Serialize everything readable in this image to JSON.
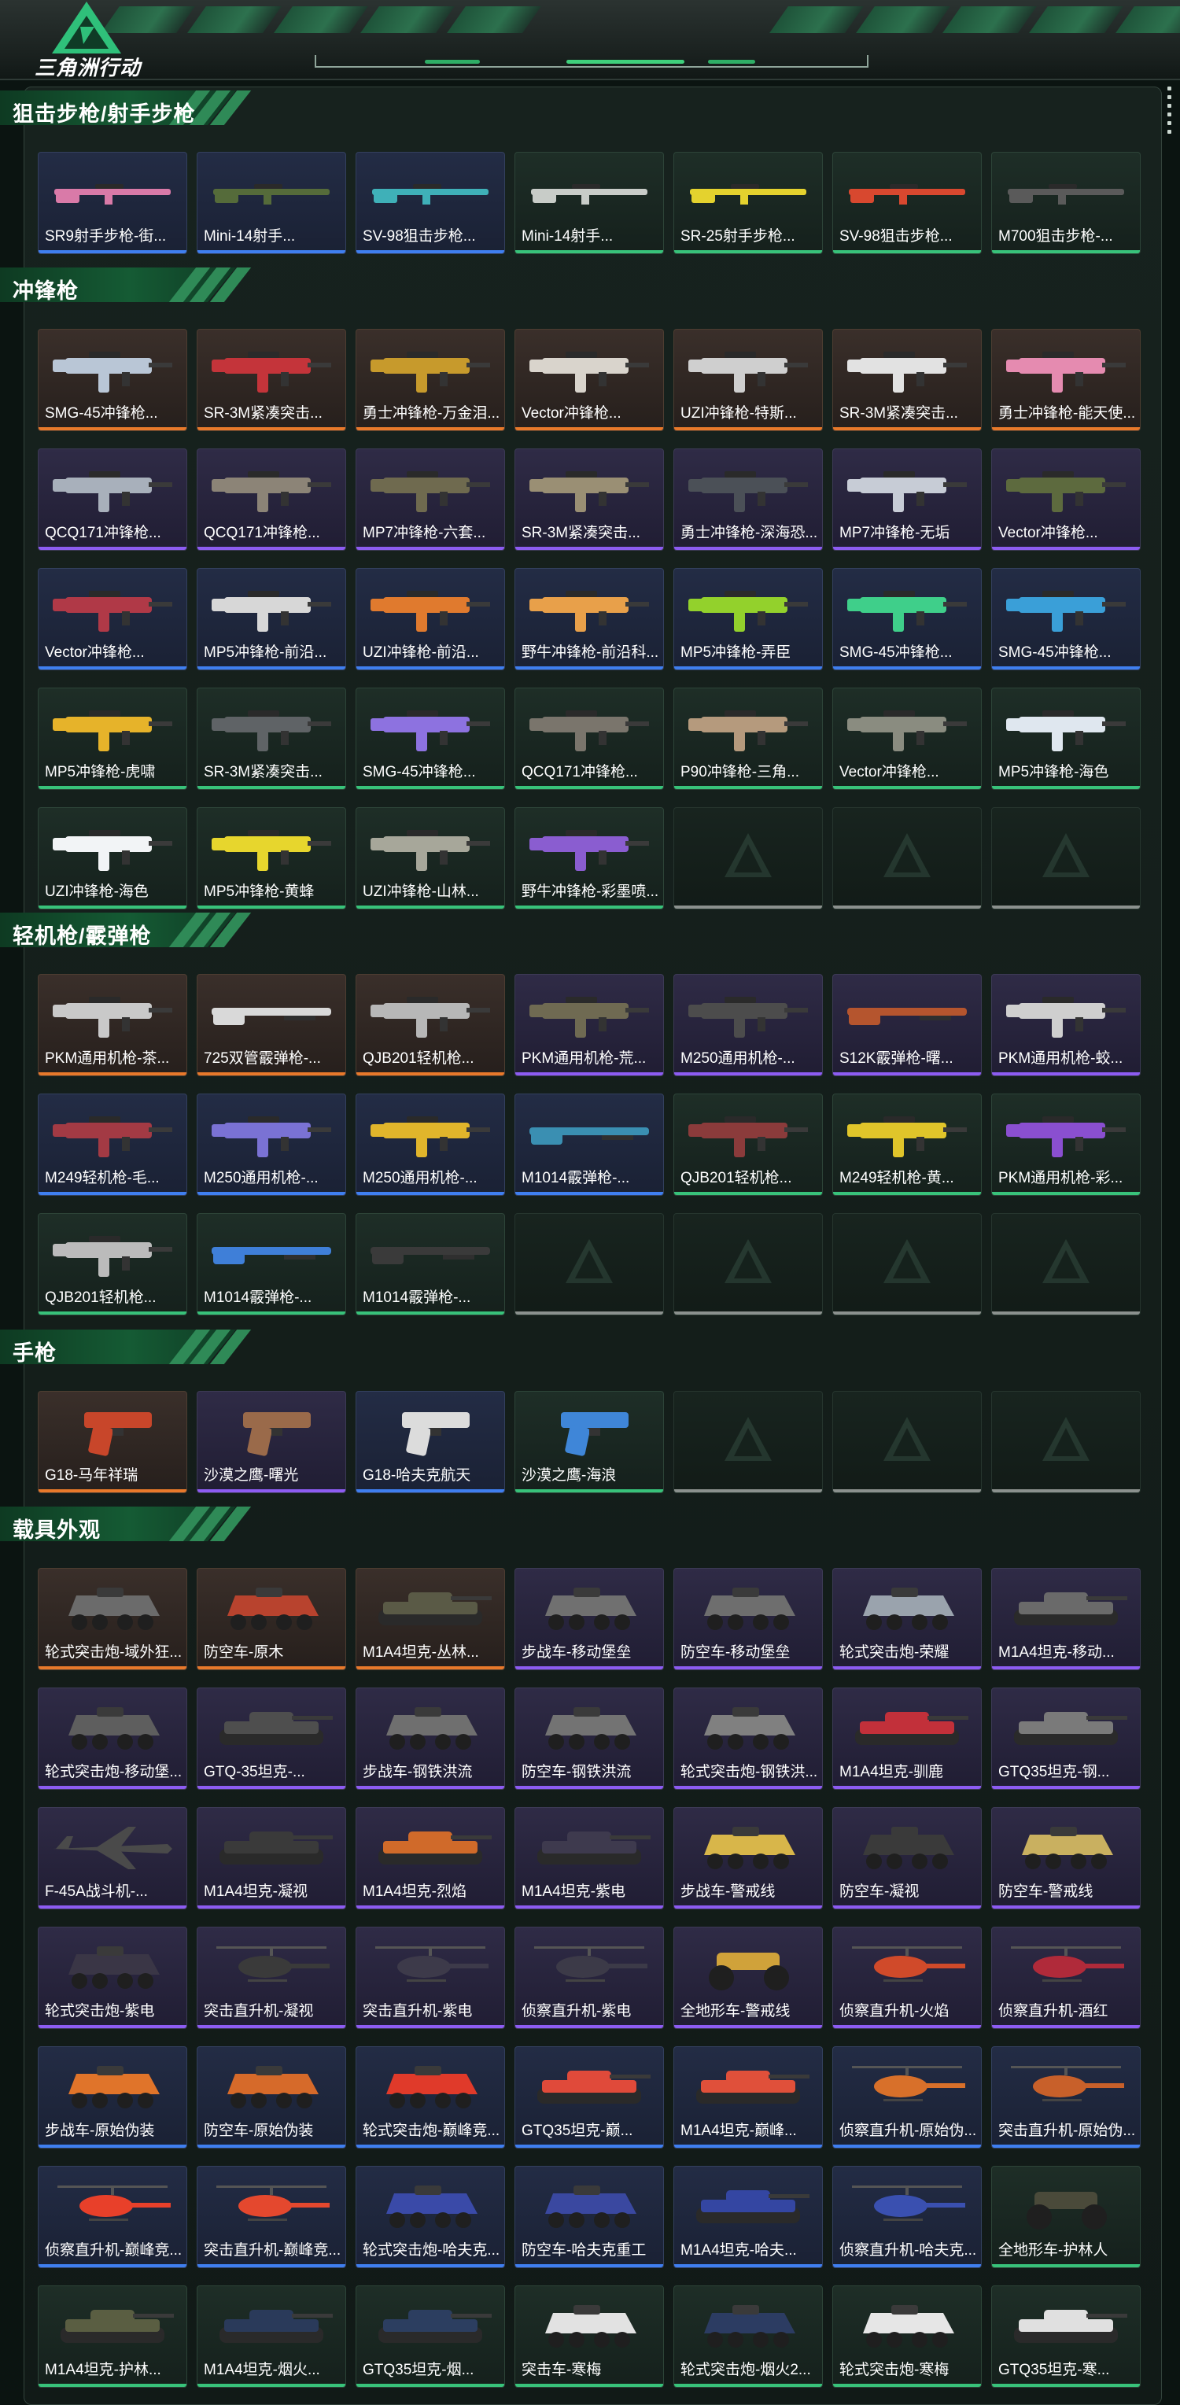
{
  "brand": {
    "logo_text": "三角洲行动",
    "accent": "#2e9a5e"
  },
  "rarity_colors": {
    "orange": "#e8792b",
    "purple": "#8d5cf2",
    "blue": "#3f7ff0",
    "green": "#38c27a",
    "empty": "#8b918e"
  },
  "sections": [
    {
      "title": "狙击步枪/射手步枪",
      "items": [
        {
          "name": "SR9射手步枪-街...",
          "rarity": "blue",
          "icon": "rifle-icon",
          "color": "#d97aa8"
        },
        {
          "name": "Mini-14射手...",
          "rarity": "blue",
          "icon": "rifle-icon",
          "color": "#556b3a"
        },
        {
          "name": "SV-98狙击步枪...",
          "rarity": "blue",
          "icon": "rifle-icon",
          "color": "#3fb0b8"
        },
        {
          "name": "Mini-14射手...",
          "rarity": "green",
          "icon": "rifle-icon",
          "color": "#c8ccc8"
        },
        {
          "name": "SR-25射手步枪...",
          "rarity": "green",
          "icon": "rifle-icon",
          "color": "#e4d22e"
        },
        {
          "name": "SV-98狙击步枪...",
          "rarity": "green",
          "icon": "rifle-icon",
          "color": "#d8482f"
        },
        {
          "name": "M700狙击步枪-...",
          "rarity": "green",
          "icon": "rifle-icon",
          "color": "#5a5a5a"
        }
      ]
    },
    {
      "title": "冲锋枪",
      "items": [
        {
          "name": "SMG-45冲锋枪...",
          "rarity": "orange",
          "icon": "smg-icon",
          "color": "#b9c6d6"
        },
        {
          "name": "SR-3M紧凑突击...",
          "rarity": "orange",
          "icon": "smg-icon",
          "color": "#c4343a"
        },
        {
          "name": "勇士冲锋枪-万金泪...",
          "rarity": "orange",
          "icon": "smg-icon",
          "color": "#c79a2c"
        },
        {
          "name": "Vector冲锋枪...",
          "rarity": "orange",
          "icon": "smg-icon",
          "color": "#d9d4cc"
        },
        {
          "name": "UZI冲锋枪-特斯...",
          "rarity": "orange",
          "icon": "smg-icon",
          "color": "#cfcfcf"
        },
        {
          "name": "SR-3M紧凑突击...",
          "rarity": "orange",
          "icon": "smg-icon",
          "color": "#e2e2e2"
        },
        {
          "name": "勇士冲锋枪-能天使...",
          "rarity": "orange",
          "icon": "smg-icon",
          "color": "#e58bb0"
        },
        {
          "name": "QCQ171冲锋枪...",
          "rarity": "purple",
          "icon": "smg-icon",
          "color": "#a8b0bb"
        },
        {
          "name": "QCQ171冲锋枪...",
          "rarity": "purple",
          "icon": "smg-icon",
          "color": "#8c8477"
        },
        {
          "name": "MP7冲锋枪-六套...",
          "rarity": "purple",
          "icon": "smg-icon",
          "color": "#6f6a4f"
        },
        {
          "name": "SR-3M紧凑突击...",
          "rarity": "purple",
          "icon": "smg-icon",
          "color": "#9a8f74"
        },
        {
          "name": "勇士冲锋枪-深海恐...",
          "rarity": "purple",
          "icon": "smg-icon",
          "color": "#4b5057"
        },
        {
          "name": "MP7冲锋枪-无垢",
          "rarity": "purple",
          "icon": "smg-icon",
          "color": "#c7ccd6"
        },
        {
          "name": "Vector冲锋枪...",
          "rarity": "purple",
          "icon": "smg-icon",
          "color": "#5d6a3e"
        },
        {
          "name": "Vector冲锋枪...",
          "rarity": "blue",
          "icon": "smg-icon",
          "color": "#b03947"
        },
        {
          "name": "MP5冲锋枪-前沿...",
          "rarity": "blue",
          "icon": "smg-icon",
          "color": "#d7d7d7"
        },
        {
          "name": "UZI冲锋枪-前沿...",
          "rarity": "blue",
          "icon": "smg-icon",
          "color": "#e07a2e"
        },
        {
          "name": "野牛冲锋枪-前沿科...",
          "rarity": "blue",
          "icon": "smg-icon",
          "color": "#e8a04a"
        },
        {
          "name": "MP5冲锋枪-弄臣",
          "rarity": "blue",
          "icon": "smg-icon",
          "color": "#93d12c"
        },
        {
          "name": "SMG-45冲锋枪...",
          "rarity": "blue",
          "icon": "smg-icon",
          "color": "#3fcf8a"
        },
        {
          "name": "SMG-45冲锋枪...",
          "rarity": "blue",
          "icon": "smg-icon",
          "color": "#3a9fd8"
        },
        {
          "name": "MP5冲锋枪-虎啸",
          "rarity": "green",
          "icon": "smg-icon",
          "color": "#e6b32a"
        },
        {
          "name": "SR-3M紧凑突击...",
          "rarity": "green",
          "icon": "smg-icon",
          "color": "#5f6366"
        },
        {
          "name": "SMG-45冲锋枪...",
          "rarity": "green",
          "icon": "smg-icon",
          "color": "#8d72e0"
        },
        {
          "name": "QCQ171冲锋枪...",
          "rarity": "green",
          "icon": "smg-icon",
          "color": "#7a756c"
        },
        {
          "name": "P90冲锋枪-三角...",
          "rarity": "green",
          "icon": "smg-icon",
          "color": "#b59a7d"
        },
        {
          "name": "Vector冲锋枪...",
          "rarity": "green",
          "icon": "smg-icon",
          "color": "#8a8c80"
        },
        {
          "name": "MP5冲锋枪-海色",
          "rarity": "green",
          "icon": "smg-icon",
          "color": "#dfe7ef"
        },
        {
          "name": "UZI冲锋枪-海色",
          "rarity": "green",
          "icon": "smg-icon",
          "color": "#f2f4f6"
        },
        {
          "name": "MP5冲锋枪-黄蜂",
          "rarity": "green",
          "icon": "smg-icon",
          "color": "#e7d62d"
        },
        {
          "name": "UZI冲锋枪-山林...",
          "rarity": "green",
          "icon": "smg-icon",
          "color": "#a7a79a"
        },
        {
          "name": "野牛冲锋枪-彩墨喷...",
          "rarity": "green",
          "icon": "smg-icon",
          "color": "#8a5dd0"
        },
        {
          "name": "",
          "rarity": "empty"
        },
        {
          "name": "",
          "rarity": "empty"
        },
        {
          "name": "",
          "rarity": "empty"
        }
      ]
    },
    {
      "title": "轻机枪/霰弹枪",
      "items": [
        {
          "name": "PKM通用机枪-茶...",
          "rarity": "orange",
          "icon": "lmg-icon",
          "color": "#c9c9c9"
        },
        {
          "name": "725双管霰弹枪-...",
          "rarity": "orange",
          "icon": "shotgun-icon",
          "color": "#d9d9d9"
        },
        {
          "name": "QJB201轻机枪...",
          "rarity": "orange",
          "icon": "lmg-icon",
          "color": "#b7b7b7"
        },
        {
          "name": "PKM通用机枪-荒...",
          "rarity": "purple",
          "icon": "lmg-icon",
          "color": "#6f6a52"
        },
        {
          "name": "M250通用机枪-...",
          "rarity": "purple",
          "icon": "lmg-icon",
          "color": "#4c4c4c"
        },
        {
          "name": "S12K霰弹枪-曙...",
          "rarity": "purple",
          "icon": "shotgun-icon",
          "color": "#b5552e"
        },
        {
          "name": "PKM通用机枪-蛟...",
          "rarity": "purple",
          "icon": "lmg-icon",
          "color": "#cfcfcf"
        },
        {
          "name": "M249轻机枪-毛...",
          "rarity": "blue",
          "icon": "lmg-icon",
          "color": "#a33a44"
        },
        {
          "name": "M250通用机枪-...",
          "rarity": "blue",
          "icon": "lmg-icon",
          "color": "#7a72d4"
        },
        {
          "name": "M250通用机枪-...",
          "rarity": "blue",
          "icon": "lmg-icon",
          "color": "#e1b52b"
        },
        {
          "name": "M1014霰弹枪-...",
          "rarity": "blue",
          "icon": "shotgun-icon",
          "color": "#3a8fb2"
        },
        {
          "name": "QJB201轻机枪...",
          "rarity": "green",
          "icon": "lmg-icon",
          "color": "#8b3b3b"
        },
        {
          "name": "M249轻机枪-黄...",
          "rarity": "green",
          "icon": "lmg-icon",
          "color": "#e0c52a"
        },
        {
          "name": "PKM通用机枪-彩...",
          "rarity": "green",
          "icon": "lmg-icon",
          "color": "#8a4fd0"
        },
        {
          "name": "QJB201轻机枪...",
          "rarity": "green",
          "icon": "lmg-icon",
          "color": "#bbbbbb"
        },
        {
          "name": "M1014霰弹枪-...",
          "rarity": "green",
          "icon": "shotgun-icon",
          "color": "#3f7fd8"
        },
        {
          "name": "M1014霰弹枪-...",
          "rarity": "green",
          "icon": "shotgun-icon",
          "color": "#3a3a3a"
        },
        {
          "name": "",
          "rarity": "empty"
        },
        {
          "name": "",
          "rarity": "empty"
        },
        {
          "name": "",
          "rarity": "empty"
        },
        {
          "name": "",
          "rarity": "empty"
        }
      ]
    },
    {
      "title": "手枪",
      "items": [
        {
          "name": "G18-马年祥瑞",
          "rarity": "orange",
          "icon": "pistol-icon",
          "color": "#c8462a"
        },
        {
          "name": "沙漠之鹰-曙光",
          "rarity": "purple",
          "icon": "pistol-icon",
          "color": "#9a6a4a"
        },
        {
          "name": "G18-哈夫克航天",
          "rarity": "blue",
          "icon": "pistol-icon",
          "color": "#dcdcdc"
        },
        {
          "name": "沙漠之鹰-海浪",
          "rarity": "green",
          "icon": "pistol-icon",
          "color": "#3f86d8"
        },
        {
          "name": "",
          "rarity": "empty"
        },
        {
          "name": "",
          "rarity": "empty"
        },
        {
          "name": "",
          "rarity": "empty"
        }
      ]
    },
    {
      "title": "载具外观",
      "items": [
        {
          "name": "轮式突击炮-域外狂...",
          "rarity": "orange",
          "icon": "armored-vehicle-icon",
          "color": "#6b6b6b"
        },
        {
          "name": "防空车-原木",
          "rarity": "orange",
          "icon": "armored-vehicle-icon",
          "color": "#b8432e"
        },
        {
          "name": "M1A4坦克-丛林...",
          "rarity": "orange",
          "icon": "tank-icon",
          "color": "#5a5a46"
        },
        {
          "name": "步战车-移动堡垒",
          "rarity": "purple",
          "icon": "armored-vehicle-icon",
          "color": "#707070"
        },
        {
          "name": "防空车-移动堡垒",
          "rarity": "purple",
          "icon": "armored-vehicle-icon",
          "color": "#6e6e6e"
        },
        {
          "name": "轮式突击炮-荣耀",
          "rarity": "purple",
          "icon": "armored-vehicle-icon",
          "color": "#9aa3ad"
        },
        {
          "name": "M1A4坦克-移动...",
          "rarity": "purple",
          "icon": "tank-icon",
          "color": "#6a6a6a"
        },
        {
          "name": "轮式突击炮-移动堡...",
          "rarity": "purple",
          "icon": "armored-vehicle-icon",
          "color": "#5e5e5e"
        },
        {
          "name": "GTQ-35坦克-...",
          "rarity": "purple",
          "icon": "tank-icon",
          "color": "#4e4e4e"
        },
        {
          "name": "步战车-钢铁洪流",
          "rarity": "purple",
          "icon": "armored-vehicle-icon",
          "color": "#6f6f6f"
        },
        {
          "name": "防空车-钢铁洪流",
          "rarity": "purple",
          "icon": "armored-vehicle-icon",
          "color": "#737373"
        },
        {
          "name": "轮式突击炮-钢铁洪...",
          "rarity": "purple",
          "icon": "armored-vehicle-icon",
          "color": "#808080"
        },
        {
          "name": "M1A4坦克-驯鹿",
          "rarity": "purple",
          "icon": "tank-icon",
          "color": "#c2303a"
        },
        {
          "name": "GTQ35坦克-钢...",
          "rarity": "purple",
          "icon": "tank-icon",
          "color": "#7a7a7a"
        },
        {
          "name": "F-45A战斗机-...",
          "rarity": "purple",
          "icon": "jet-icon",
          "color": "#4a4a4a"
        },
        {
          "name": "M1A4坦克-凝视",
          "rarity": "purple",
          "icon": "tank-icon",
          "color": "#3a3a3a"
        },
        {
          "name": "M1A4坦克-烈焰",
          "rarity": "purple",
          "icon": "tank-icon",
          "color": "#d06a2a"
        },
        {
          "name": "M1A4坦克-紫电",
          "rarity": "purple",
          "icon": "tank-icon",
          "color": "#3e3a4e"
        },
        {
          "name": "步战车-警戒线",
          "rarity": "purple",
          "icon": "armored-vehicle-icon",
          "color": "#d8b64a"
        },
        {
          "name": "防空车-凝视",
          "rarity": "purple",
          "icon": "armored-vehicle-icon",
          "color": "#3a3a3a"
        },
        {
          "name": "防空车-警戒线",
          "rarity": "purple",
          "icon": "armored-vehicle-icon",
          "color": "#c9b060"
        },
        {
          "name": "轮式突击炮-紫电",
          "rarity": "purple",
          "icon": "armored-vehicle-icon",
          "color": "#3a3646"
        },
        {
          "name": "突击直升机-凝视",
          "rarity": "purple",
          "icon": "helicopter-icon",
          "color": "#3a3a3a"
        },
        {
          "name": "突击直升机-紫电",
          "rarity": "purple",
          "icon": "helicopter-icon",
          "color": "#3d3a4a"
        },
        {
          "name": "侦察直升机-紫电",
          "rarity": "purple",
          "icon": "helicopter-icon",
          "color": "#3c3a48"
        },
        {
          "name": "全地形车-警戒线",
          "rarity": "purple",
          "icon": "atv-icon",
          "color": "#d0a23a"
        },
        {
          "name": "侦察直升机-火焰",
          "rarity": "purple",
          "icon": "helicopter-icon",
          "color": "#d04a2a"
        },
        {
          "name": "侦察直升机-酒红",
          "rarity": "purple",
          "icon": "helicopter-icon",
          "color": "#b02a3a"
        },
        {
          "name": "步战车-原始伪装",
          "rarity": "blue",
          "icon": "armored-vehicle-icon",
          "color": "#e0742a"
        },
        {
          "name": "防空车-原始伪装",
          "rarity": "blue",
          "icon": "armored-vehicle-icon",
          "color": "#d66a2a"
        },
        {
          "name": "轮式突击炮-巅峰竞...",
          "rarity": "blue",
          "icon": "armored-vehicle-icon",
          "color": "#e03a2a"
        },
        {
          "name": "GTQ35坦克-巅...",
          "rarity": "blue",
          "icon": "tank-icon",
          "color": "#e04a3a"
        },
        {
          "name": "M1A4坦克-巅峰...",
          "rarity": "blue",
          "icon": "tank-icon",
          "color": "#e0503a"
        },
        {
          "name": "侦察直升机-原始伪...",
          "rarity": "blue",
          "icon": "helicopter-icon",
          "color": "#d8702a"
        },
        {
          "name": "突击直升机-原始伪...",
          "rarity": "blue",
          "icon": "helicopter-icon",
          "color": "#c8602a"
        },
        {
          "name": "侦察直升机-巅峰竞...",
          "rarity": "blue",
          "icon": "helicopter-icon",
          "color": "#e8402a"
        },
        {
          "name": "突击直升机-巅峰竞...",
          "rarity": "blue",
          "icon": "helicopter-icon",
          "color": "#e4482e"
        },
        {
          "name": "轮式突击炮-哈夫克...",
          "rarity": "blue",
          "icon": "armored-vehicle-icon",
          "color": "#3a4aa8"
        },
        {
          "name": "防空车-哈夫克重工",
          "rarity": "blue",
          "icon": "armored-vehicle-icon",
          "color": "#3a48a0"
        },
        {
          "name": "M1A4坦克-哈夫...",
          "rarity": "blue",
          "icon": "tank-icon",
          "color": "#3446a2"
        },
        {
          "name": "侦察直升机-哈夫克...",
          "rarity": "blue",
          "icon": "helicopter-icon",
          "color": "#3a50b0"
        },
        {
          "name": "全地形车-护林人",
          "rarity": "green",
          "icon": "atv-icon",
          "color": "#4a4a3a"
        },
        {
          "name": "M1A4坦克-护林...",
          "rarity": "green",
          "icon": "tank-icon",
          "color": "#5a5e42"
        },
        {
          "name": "M1A4坦克-烟火...",
          "rarity": "green",
          "icon": "tank-icon",
          "color": "#2a3a5a"
        },
        {
          "name": "GTQ35坦克-烟...",
          "rarity": "green",
          "icon": "tank-icon",
          "color": "#2c3e60"
        },
        {
          "name": "突击车-寒梅",
          "rarity": "green",
          "icon": "armored-vehicle-icon",
          "color": "#e2e2e2"
        },
        {
          "name": "轮式突击炮-烟火2...",
          "rarity": "green",
          "icon": "armored-vehicle-icon",
          "color": "#2c3c62"
        },
        {
          "name": "轮式突击炮-寒梅",
          "rarity": "green",
          "icon": "armored-vehicle-icon",
          "color": "#e6e6e6"
        },
        {
          "name": "GTQ35坦克-寒...",
          "rarity": "green",
          "icon": "tank-icon",
          "color": "#e0e0e0"
        }
      ]
    }
  ]
}
